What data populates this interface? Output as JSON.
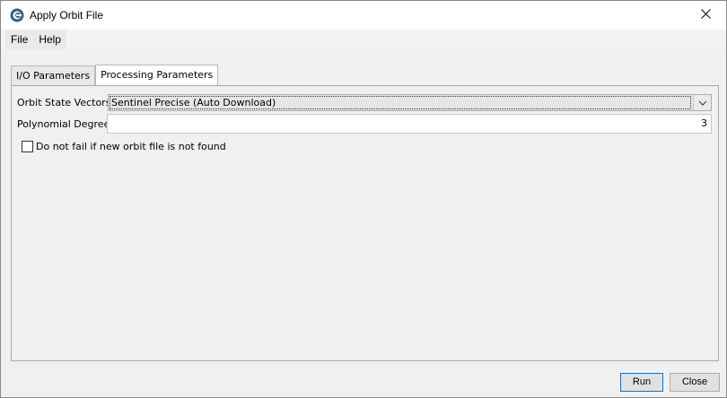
{
  "window": {
    "title": "Apply Orbit File",
    "app_icon": "esa-snap-icon",
    "close_icon": "close-icon"
  },
  "menubar": {
    "items": [
      "File",
      "Help"
    ]
  },
  "tabs": [
    {
      "label": "I/O Parameters",
      "active": false
    },
    {
      "label": "Processing Parameters",
      "active": true
    }
  ],
  "form": {
    "orbit_label": "Orbit State Vectors:",
    "orbit_value": "Sentinel Precise (Auto Download)",
    "poly_label": "Polynomial Degree:",
    "poly_value": "3",
    "checkbox_label": "Do not fail if new orbit file is not found",
    "checkbox_checked": false
  },
  "buttons": {
    "run": "Run",
    "close": "Close"
  },
  "colors": {
    "default_button_border": "#0078d7",
    "window_bg": "#f0f0f0"
  }
}
